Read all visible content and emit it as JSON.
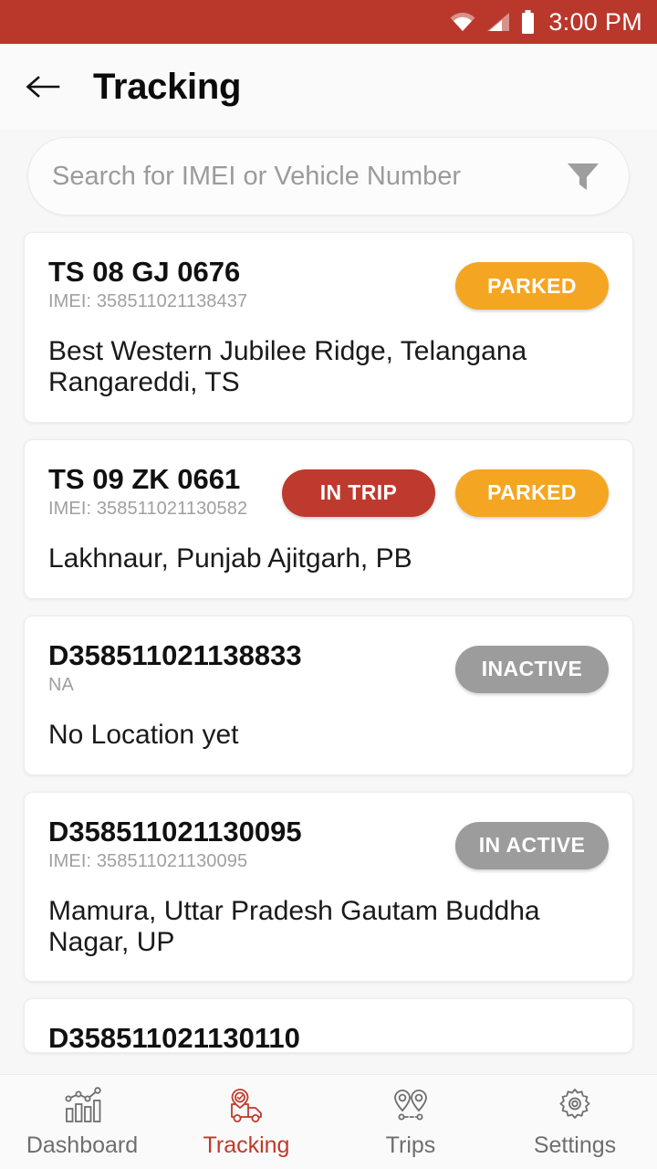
{
  "status_bar": {
    "time": "3:00 PM",
    "background_color": "#BA372B",
    "icons": [
      "wifi-icon",
      "cellular-signal-icon",
      "battery-icon"
    ]
  },
  "app_bar": {
    "back_icon": "back-arrow-icon",
    "title": "Tracking"
  },
  "search": {
    "placeholder": "Search for IMEI or Vehicle Number",
    "value": "",
    "filter_icon": "filter-funnel-icon"
  },
  "status_colors": {
    "parked": "#F4A623",
    "in_trip": "#BE3A2E",
    "inactive": "#9C9C9C"
  },
  "vehicles": [
    {
      "vehicle_number": "TS 08 GJ 0676",
      "imei": "IMEI: 358511021138437",
      "badges": [
        {
          "label": "PARKED",
          "type": "parked"
        }
      ],
      "address": "Best Western Jubilee Ridge, Telangana Rangareddi, TS"
    },
    {
      "vehicle_number": "TS 09 ZK 0661",
      "imei": "IMEI: 358511021130582",
      "badges": [
        {
          "label": "IN TRIP",
          "type": "intrip"
        },
        {
          "label": "PARKED",
          "type": "parked"
        }
      ],
      "address": "Lakhnaur, Punjab Ajitgarh, PB"
    },
    {
      "vehicle_number": "D358511021138833",
      "imei": "NA",
      "badges": [
        {
          "label": "INACTIVE",
          "type": "inactive"
        }
      ],
      "address": "No Location yet"
    },
    {
      "vehicle_number": "D358511021130095",
      "imei": "IMEI: 358511021130095",
      "badges": [
        {
          "label": "IN ACTIVE",
          "type": "inactive"
        }
      ],
      "address": "Mamura, Uttar Pradesh Gautam Buddha Nagar, UP"
    },
    {
      "vehicle_number": "D358511021130110",
      "imei": "",
      "badges": [],
      "address": ""
    }
  ],
  "bottom_nav": {
    "active_color": "#C0392B",
    "items": [
      {
        "label": "Dashboard",
        "icon": "dashboard-chart-icon",
        "active": false
      },
      {
        "label": "Tracking",
        "icon": "tracking-truck-icon",
        "active": true
      },
      {
        "label": "Trips",
        "icon": "trips-route-pins-icon",
        "active": false
      },
      {
        "label": "Settings",
        "icon": "settings-gear-icon",
        "active": false
      }
    ]
  }
}
